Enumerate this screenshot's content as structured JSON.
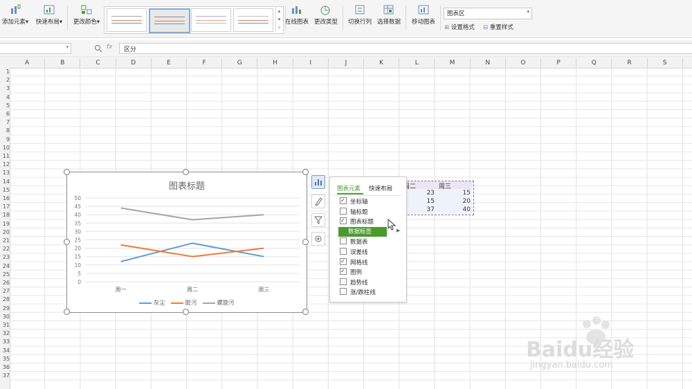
{
  "ribbon": {
    "add_element": "添加元素",
    "quick_layout": "快速布局",
    "change_color": "更改颜色",
    "online_chart": "在线图表",
    "change_type": "更改类型",
    "switch_row_col": "切换行列",
    "select_data": "选择数据",
    "move_chart": "移动图表",
    "area_select": "图表区",
    "set_format": "设置格式",
    "reset_style": "重置样式"
  },
  "formula_bar": {
    "fx": "fx",
    "value": "区分"
  },
  "columns": [
    "A",
    "B",
    "C",
    "D",
    "E",
    "F",
    "G",
    "H",
    "I",
    "J",
    "K",
    "L",
    "M",
    "N",
    "O",
    "P",
    "Q",
    "R",
    "S"
  ],
  "rows": [
    "1",
    "2",
    "3",
    "4",
    "5",
    "6",
    "7",
    "8",
    "9",
    "10",
    "11",
    "12",
    "13",
    "14",
    "15",
    "16",
    "17",
    "18",
    "19",
    "20",
    "21",
    "22",
    "23",
    "24",
    "25",
    "26",
    "27",
    "28",
    "29",
    "30",
    "31",
    "32",
    "33",
    "34",
    "35",
    "36",
    "37"
  ],
  "sheet_cells": {
    "header_l": "周二",
    "header_m": "周三",
    "l15": "23",
    "m15": "15",
    "l16": "15",
    "m16": "20",
    "l17": "37",
    "m17": "40"
  },
  "chart_data": {
    "type": "line",
    "title": "图表标题",
    "categories": [
      "周一",
      "周二",
      "周三"
    ],
    "ylim": [
      0,
      50
    ],
    "yticks": [
      0,
      5,
      10,
      15,
      20,
      25,
      30,
      35,
      40,
      45,
      50
    ],
    "grid": true,
    "legend_position": "bottom",
    "series": [
      {
        "name": "灰尘",
        "values": [
          12,
          23,
          15
        ],
        "color": "#5b9bd5"
      },
      {
        "name": "脏污",
        "values": [
          22,
          15,
          20
        ],
        "color": "#ed7d31"
      },
      {
        "name": "螺旋污",
        "values": [
          44,
          37,
          40
        ],
        "color": "#a5a5a5"
      }
    ]
  },
  "panel": {
    "tab_elements": "图表元素",
    "tab_layout": "快速布局",
    "items": [
      {
        "label": "坐标轴",
        "checked": true
      },
      {
        "label": "轴标题",
        "checked": false
      },
      {
        "label": "图表标题",
        "checked": true
      },
      {
        "label": "数据标签",
        "checked": false,
        "highlight": true
      },
      {
        "label": "数据表",
        "checked": false
      },
      {
        "label": "误差线",
        "checked": false
      },
      {
        "label": "网格线",
        "checked": true
      },
      {
        "label": "图例",
        "checked": true
      },
      {
        "label": "趋势线",
        "checked": false
      },
      {
        "label": "涨/跌柱线",
        "checked": false
      }
    ],
    "accent": "#4a9a2e"
  },
  "watermark": {
    "brand": "Baidu经验",
    "url": "jingyan.baidu.com"
  }
}
